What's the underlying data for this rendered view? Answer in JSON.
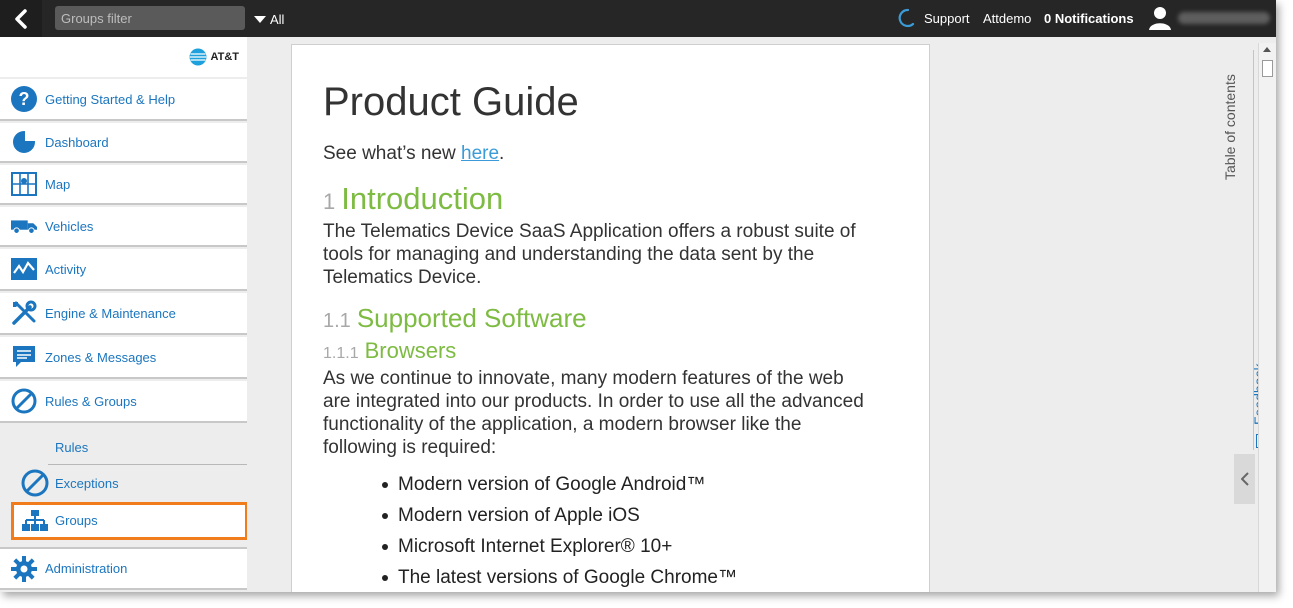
{
  "topbar": {
    "filter_placeholder": "Groups filter",
    "scope_label": "All",
    "support_label": "Support",
    "user_label": "Attdemo",
    "notifications_label": "0 Notifications"
  },
  "sidebar": {
    "logo_text": "AT&T",
    "items": [
      {
        "label": "Getting Started & Help",
        "icon": "help-icon"
      },
      {
        "label": "Dashboard",
        "icon": "pie-chart-icon"
      },
      {
        "label": "Map",
        "icon": "map-icon"
      },
      {
        "label": "Vehicles",
        "icon": "truck-icon"
      },
      {
        "label": "Activity",
        "icon": "activity-chart-icon"
      },
      {
        "label": "Engine & Maintenance",
        "icon": "tools-icon"
      },
      {
        "label": "Zones & Messages",
        "icon": "message-icon"
      },
      {
        "label": "Rules & Groups",
        "icon": "prohibit-icon"
      }
    ],
    "sub_items": [
      {
        "label": "Rules"
      },
      {
        "label": "Exceptions",
        "icon": "prohibit-icon"
      },
      {
        "label": "Groups",
        "icon": "org-chart-icon"
      }
    ],
    "admin": {
      "label": "Administration",
      "icon": "gear-icon"
    }
  },
  "doc": {
    "title": "Product Guide",
    "whatsnew_prefix": "See what’s new ",
    "whatsnew_link": "here",
    "whatsnew_suffix": ".",
    "h1_num": "1",
    "h1_text": "Introduction",
    "intro_lines": [
      "The Telematics Device SaaS Application offers a robust suite of",
      "tools for managing and understanding the data sent by the",
      "Telematics Device."
    ],
    "h2_num": "1.1",
    "h2_text": "Supported Software",
    "h3_num": "1.1.1",
    "h3_text": "Browsers",
    "browsers_lines": [
      "As we continue to innovate, many modern features of the web",
      "are integrated into our products. In order to use all the advanced",
      "functionality of the application, a modern browser like the",
      "following is required:"
    ],
    "bullets": [
      "Modern version of Google Android™",
      "Modern version of Apple iOS",
      "Microsoft Internet Explorer® 10+",
      "The latest versions of Google Chrome™"
    ]
  },
  "rail": {
    "toc_label": "Table of contents",
    "feedback_label": "Feedback"
  },
  "colors": {
    "accent_blue": "#1b76bf",
    "heading_green": "#7dbb42",
    "highlight_orange": "#f07c1c",
    "topbar": "#262626"
  }
}
